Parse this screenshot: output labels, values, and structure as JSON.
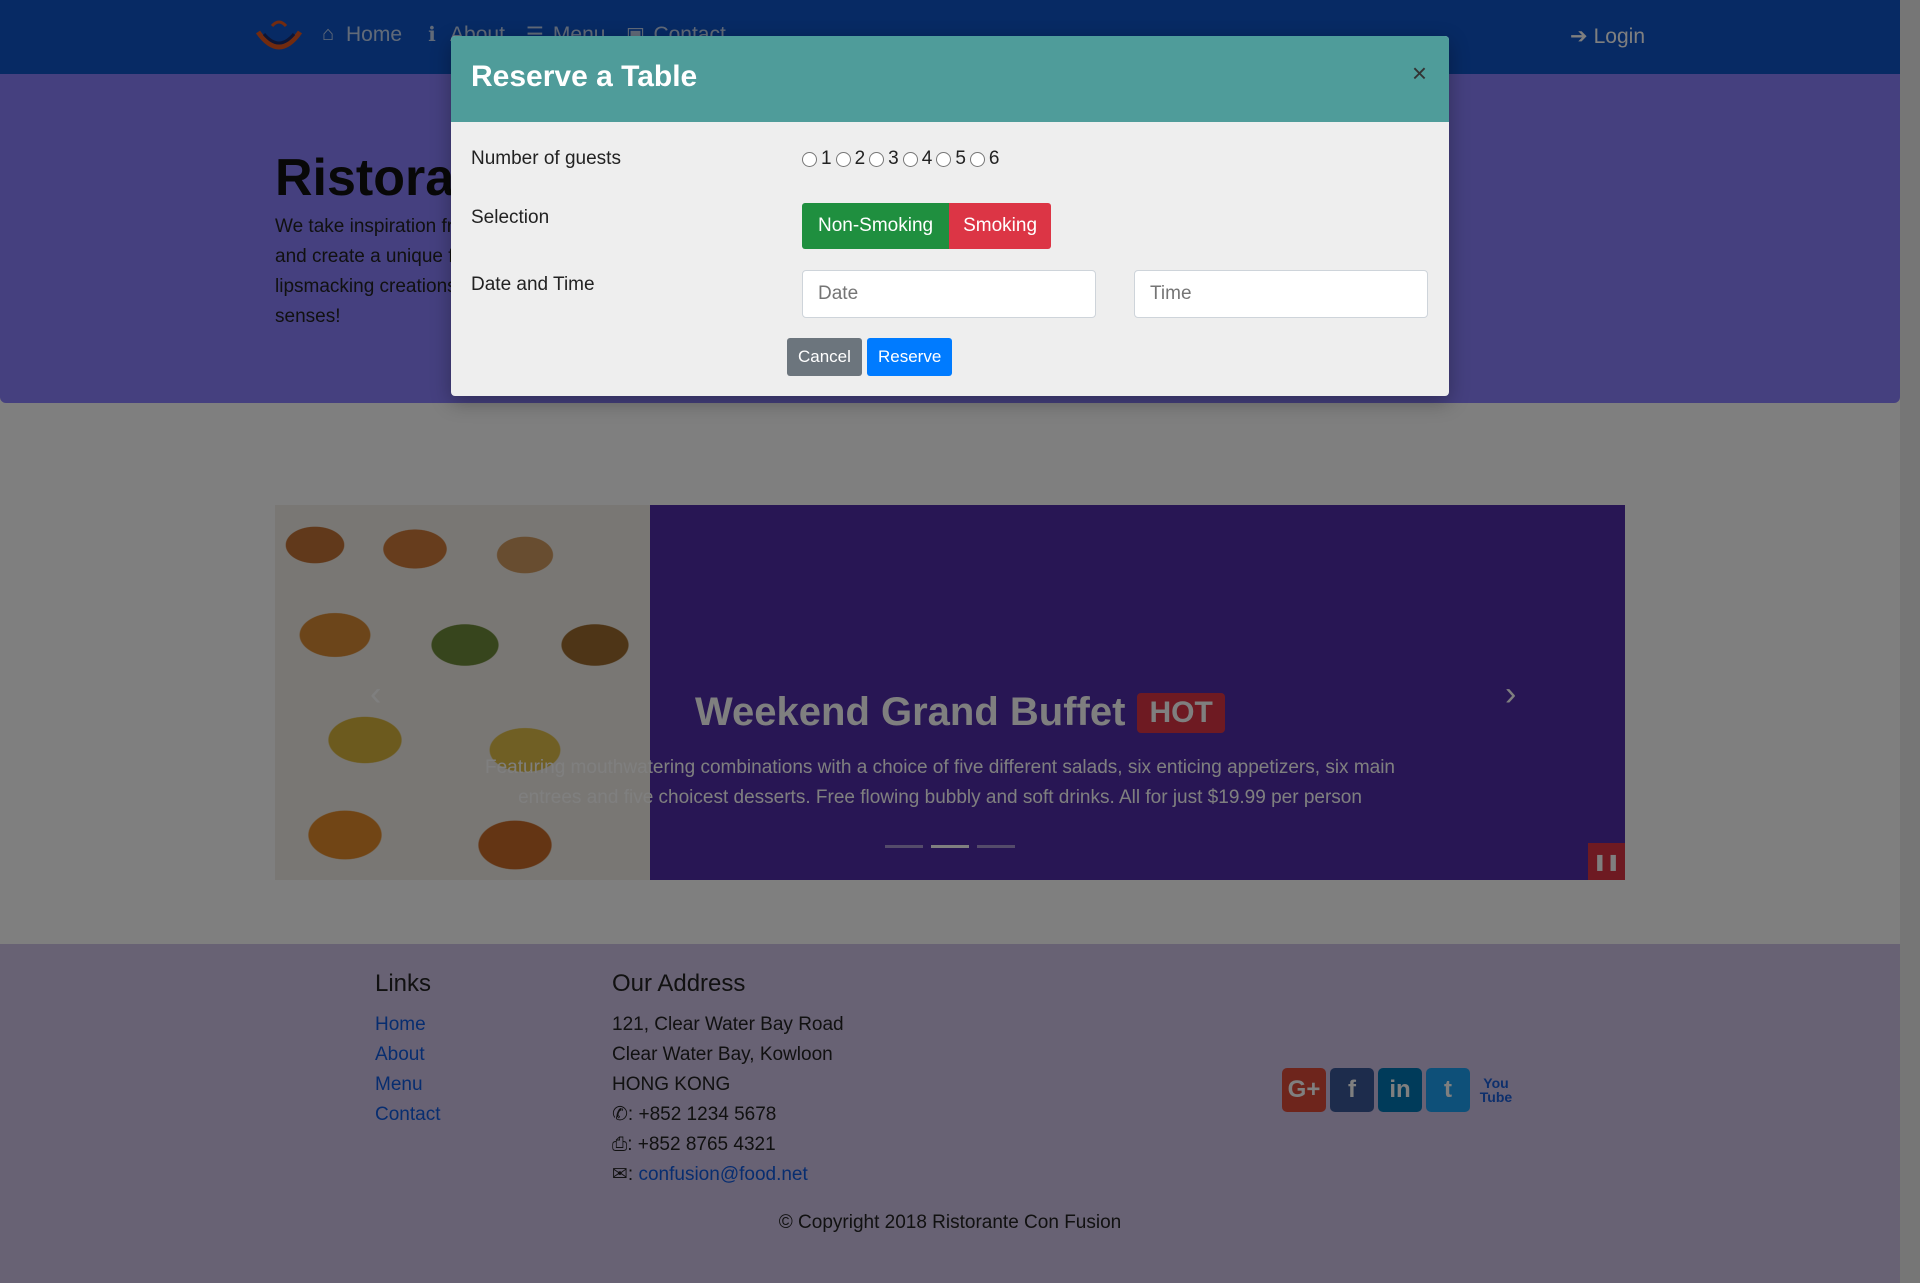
{
  "nav": {
    "items": [
      {
        "icon": "home-icon",
        "label": "Home"
      },
      {
        "icon": "info-icon",
        "label": "About"
      },
      {
        "icon": "list-icon",
        "label": "Menu"
      },
      {
        "icon": "address-card-icon",
        "label": "Contact"
      }
    ],
    "login_label": "Login"
  },
  "jumbotron": {
    "title": "Ristorante Con Fusion",
    "text": "We take inspiration from the World's best cuisines, and create a unique fusion experience. Our lipsmacking creations will tickle your culinary senses!"
  },
  "carousel": {
    "title": "Weekend Grand Buffet",
    "badge": "HOT",
    "text": "Featuring mouthwatering combinations with a choice of five different salads, six enticing appetizers, six main entrees and five choicest desserts. Free flowing bubbly and soft drinks. All for just $19.99 per person",
    "active_index": 1
  },
  "footer": {
    "links_heading": "Links",
    "links": [
      "Home",
      "About",
      "Menu",
      "Contact"
    ],
    "address_heading": "Our Address",
    "address_lines": [
      "121, Clear Water Bay Road",
      "Clear Water Bay, Kowloon",
      "HONG KONG"
    ],
    "phone": ": +852 1234 5678",
    "fax": ": +852 8765 4321",
    "email": "confusion@food.net",
    "copyright": "© Copyright 2018 Ristorante Con Fusion",
    "social": [
      "google-plus-icon",
      "facebook-icon",
      "linkedin-icon",
      "twitter-icon",
      "youtube-icon"
    ]
  },
  "modal": {
    "title": "Reserve a Table",
    "close_glyph": "×",
    "guests_label": "Number of guests",
    "guest_options": [
      "1",
      "2",
      "3",
      "4",
      "5",
      "6"
    ],
    "selection_label": "Selection",
    "non_smoking_label": "Non-Smoking",
    "smoking_label": "Smoking",
    "datetime_label": "Date and Time",
    "date_placeholder": "Date",
    "time_placeholder": "Time",
    "cancel_label": "Cancel",
    "reserve_label": "Reserve"
  },
  "colors": {
    "navbar": "#0f55c8",
    "jumbotron": "#8a80ff",
    "carousel": "#512da8",
    "footer": "#d1c4e9",
    "modal_header": "#4f9c9a"
  }
}
